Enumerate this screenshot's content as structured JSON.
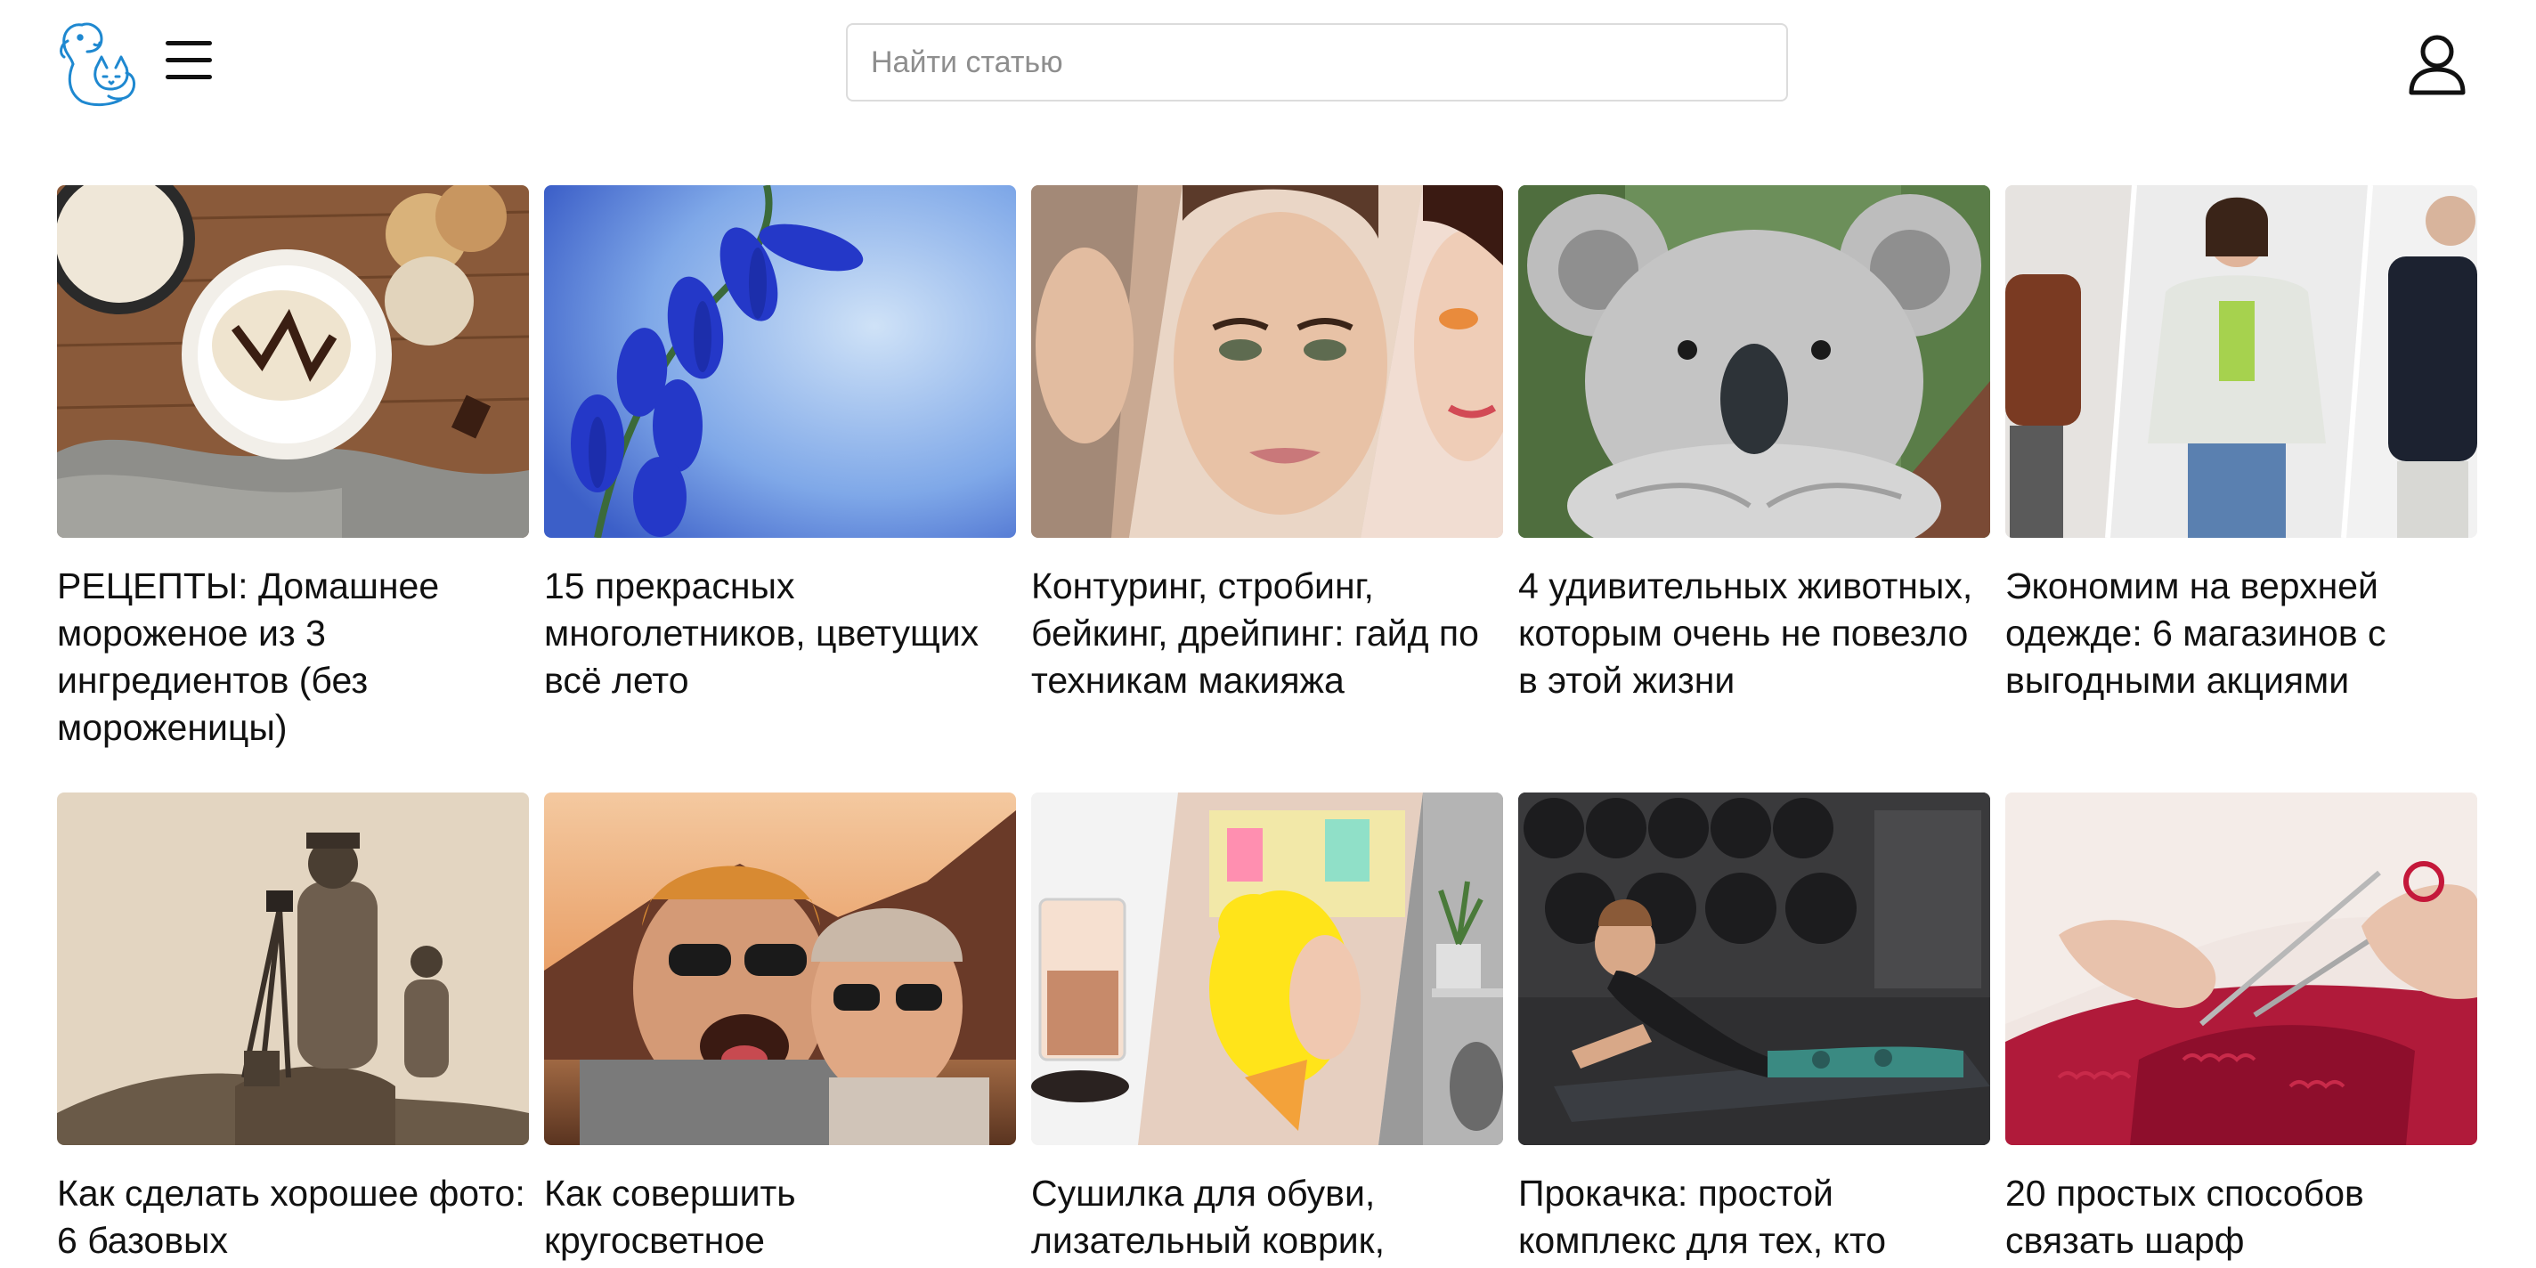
{
  "header": {
    "logo_icon": "cat-dog-logo-icon",
    "menu_icon": "hamburger-menu-icon",
    "search_placeholder": "Найти статью",
    "user_icon": "user-profile-icon",
    "brand_color": "#1e88d0"
  },
  "articles": [
    {
      "title": "РЕЦЕПТЫ: Домашнее мороженое из 3 ингредиентов (без мороженицы)",
      "image": "ice-cream-plate-photo"
    },
    {
      "title": "15 прекрасных многолетников, цветущих всё лето",
      "image": "bluebell-flowers-photo"
    },
    {
      "title": "Контуринг, стробинг, бейкинг, дрейпинг: гайд по техникам макияжа",
      "image": "makeup-faces-collage-photo"
    },
    {
      "title": "4 удивительных животных, которым очень не повезло в этой жизни",
      "image": "koala-photo"
    },
    {
      "title": "Экономим на верхней одежде: 6 магазинов с выгодными акциями",
      "image": "outerwear-models-collage-photo"
    },
    {
      "title": "Как сделать хорошее фото: 6 базовых",
      "image": "vintage-photographers-photo"
    },
    {
      "title": "Как совершить кругосветное",
      "image": "travel-selfie-couple-photo"
    },
    {
      "title": "Сушилка для обуви, лизательный коврик,",
      "image": "gadgets-collage-photo"
    },
    {
      "title": "Прокачка: простой комплекс для тех, кто",
      "image": "fitness-woman-mat-photo"
    },
    {
      "title": "20 простых способов связать шарф",
      "image": "knitting-red-yarn-photo"
    }
  ]
}
